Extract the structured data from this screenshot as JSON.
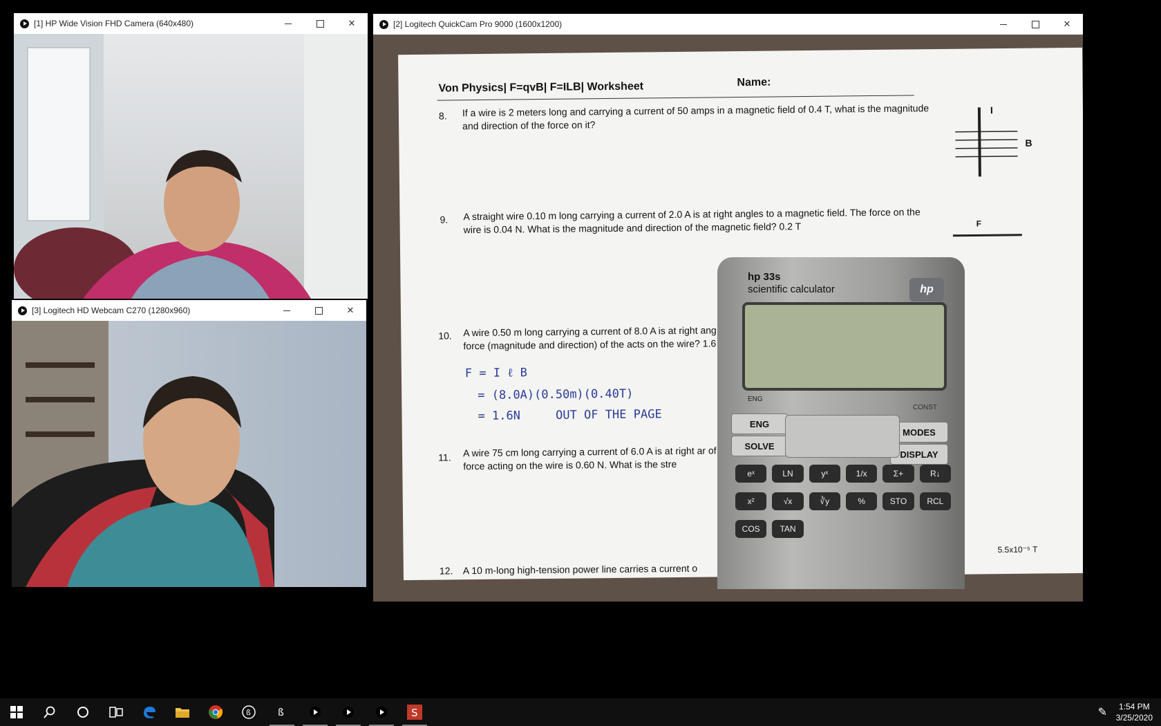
{
  "windows": {
    "cam1": {
      "title": "[1] HP Wide Vision FHD Camera (640x480)"
    },
    "cam2": {
      "title": "[2] Logitech QuickCam Pro 9000 (1600x1200)"
    },
    "cam3": {
      "title": "[3] Logitech HD Webcam C270 (1280x960)"
    }
  },
  "window_controls": {
    "close": "✕"
  },
  "worksheet": {
    "header": "Von Physics| F=qvB| F=ILB| Worksheet",
    "name_label": "Name:",
    "q8_num": "8.",
    "q8_text": "If a wire is 2 meters long and carrying a current of 50 amps in a magnetic field of 0.4 T, what is the magnitude and direction of the force on it?",
    "q9_num": "9.",
    "q9_text": "A straight wire 0.10 m long carrying a current of 2.0 A is at right angles to a magnetic field. The force on the wire is 0.04 N. What is the magnitude and direction of the magnetic field? 0.2 T",
    "q10_num": "10.",
    "q10_text": "A wire 0.50 m long carrying a current of 8.0 A is at right ang force (magnitude and direction) of the acts on the wire? 1.6",
    "q11_num": "11.",
    "q11_text": "A wire 75 cm long carrying a current of 6.0 A is at right ar of the force acting on the wire is 0.60 N. What is the stre",
    "q12_num": "12.",
    "q12_text": "A 10 m-long high-tension power line carries a current o",
    "fig_I": "I",
    "fig_B": "B",
    "fig_F": "F",
    "fig_field_value": "5.5x10⁻⁵ T",
    "handwriting": {
      "line1": "F = I ℓ B",
      "line2": "= (8.0A)(0.50m)(0.40T)",
      "line3": "= 1.6N     OUT OF THE PAGE"
    }
  },
  "calculator": {
    "brand": "hp 33s",
    "model": "scientific calculator",
    "logo": "hp",
    "eng_label": "ENG",
    "const_label": "CONST",
    "keys_top": [
      "ENG",
      "SOLVE",
      "MODES",
      "DISPLAY"
    ],
    "keys": [
      "eˣ",
      "LN",
      "yˣ",
      "1/x",
      "Σ+",
      "R↓",
      "x²",
      "√x",
      "∛y",
      "%",
      "STO",
      "RCL",
      "COS",
      "TAN"
    ]
  },
  "taskbar": {
    "start_icon": "windows-start",
    "time": "1:54 PM",
    "date": "3/25/2020"
  }
}
